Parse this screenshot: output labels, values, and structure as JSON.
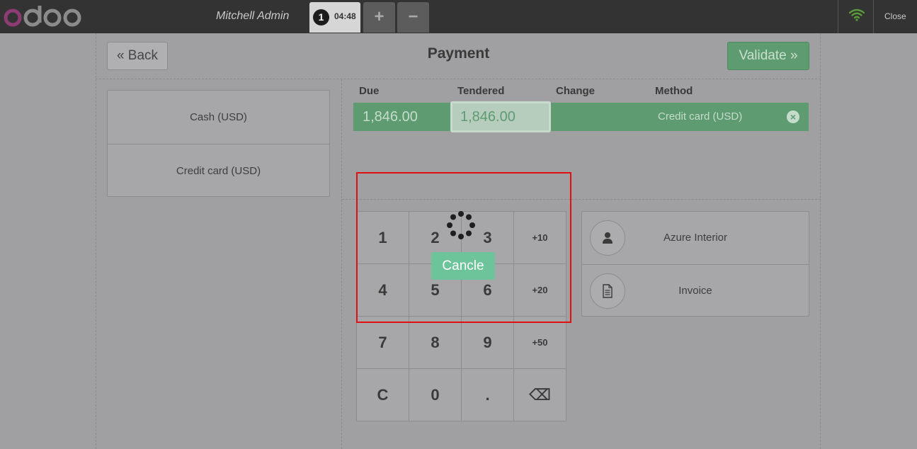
{
  "topbar": {
    "brand": "odoo",
    "user_name": "Mitchell Admin",
    "order_number": "1",
    "order_time": "04:48",
    "add_order_icon": "plus-icon",
    "remove_order_icon": "minus-icon",
    "connection_icon": "wifi-icon",
    "close_label": "Close"
  },
  "header": {
    "back_label": "« Back",
    "title": "Payment",
    "validate_label": "Validate »"
  },
  "payment_methods": [
    "Cash (USD)",
    "Credit card (USD)"
  ],
  "payment_lines": {
    "headers": [
      "Due",
      "Tendered",
      "Change",
      "Method"
    ],
    "rows": [
      {
        "due": "1,846.00",
        "tendered": "1,846.00",
        "change": "",
        "method": "Credit card (USD)"
      }
    ]
  },
  "numpad": {
    "keys": [
      "1",
      "2",
      "3",
      "+10",
      "4",
      "5",
      "6",
      "+20",
      "7",
      "8",
      "9",
      "+50",
      "C",
      "0",
      ".",
      "⌫"
    ]
  },
  "controls": {
    "customer_label": "Azure Interior",
    "customer_icon": "user-icon",
    "invoice_label": "Invoice",
    "invoice_icon": "document-icon"
  },
  "loading": {
    "cancel_label": "Cancle"
  },
  "colors": {
    "accent_green": "#5e9b71",
    "cancel_green": "#6ec49a",
    "highlight_red": "#e01010",
    "topbar_bg": "#343334"
  }
}
